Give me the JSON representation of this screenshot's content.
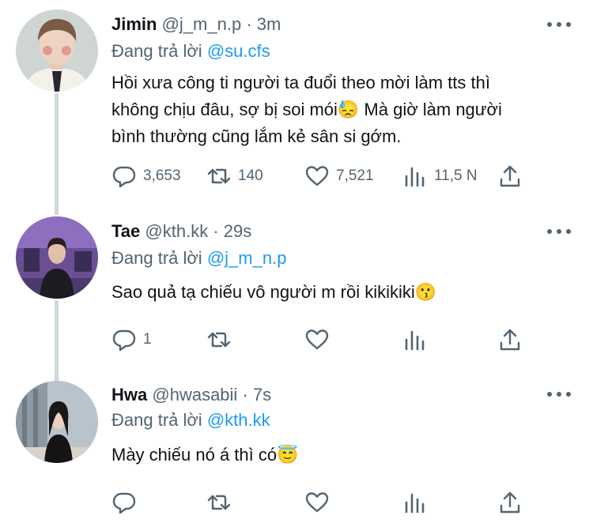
{
  "colors": {
    "text": "#0f1419",
    "muted": "#536471",
    "link": "#1d9bf0",
    "thread_line": "#cfd9de"
  },
  "tweets": [
    {
      "name": "Jimin",
      "handle": "@j_m_n.p",
      "separator": "·",
      "time": "3m",
      "replying_prefix": "Đang trả lời",
      "replying_to": "@su.cfs",
      "lines": [
        "Hồi xưa công ti người ta đuổi theo mời làm tts thì",
        "không chịu đâu, sợ bị soi mói😓  Mà giờ làm người",
        "bình thường cũng lắm kẻ sân si gớm."
      ],
      "reply_count": "3,653",
      "retweet_count": "140",
      "like_count": "7,521",
      "view_count": "11,5 N",
      "avatar": "person-avatar"
    },
    {
      "name": "Tae",
      "handle": "@kth.kk",
      "separator": "·",
      "time": "29s",
      "replying_prefix": "Đang trả lời",
      "replying_to": "@j_m_n.p",
      "lines": [
        "Sao quả tạ chiếu vô người m rồi kikikiki😗"
      ],
      "reply_count": "1",
      "retweet_count": "",
      "like_count": "",
      "view_count": "",
      "avatar": "person-avatar"
    },
    {
      "name": "Hwa",
      "handle": "@hwasabii",
      "separator": "·",
      "time": "7s",
      "replying_prefix": "Đang trả lời",
      "replying_to": "@kth.kk",
      "lines": [
        "Mày chiếu nó á thì có😇"
      ],
      "reply_count": "",
      "retweet_count": "",
      "like_count": "",
      "view_count": "",
      "avatar": "person-avatar"
    }
  ]
}
